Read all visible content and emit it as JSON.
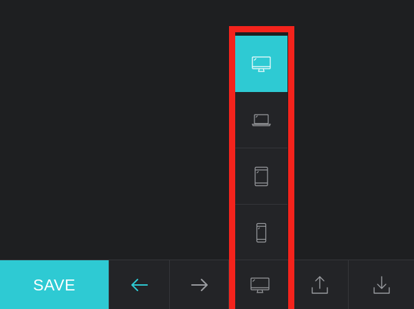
{
  "toolbar": {
    "save_label": "SAVE",
    "buttons": [
      {
        "name": "undo",
        "icon": "arrow-left-icon"
      },
      {
        "name": "redo",
        "icon": "arrow-right-icon"
      },
      {
        "name": "device",
        "icon": "desktop-monitor-icon"
      },
      {
        "name": "upload",
        "icon": "upload-icon"
      },
      {
        "name": "download",
        "icon": "download-icon"
      }
    ]
  },
  "device_menu": {
    "options": [
      {
        "device": "desktop",
        "icon": "desktop-monitor-icon",
        "selected": true
      },
      {
        "device": "laptop",
        "icon": "laptop-icon",
        "selected": false
      },
      {
        "device": "tablet",
        "icon": "tablet-icon",
        "selected": false
      },
      {
        "device": "phone",
        "icon": "phone-icon",
        "selected": false
      }
    ]
  },
  "colors": {
    "accent": "#2ecad3",
    "background": "#1e1f21",
    "panel": "#232427",
    "divider": "#35363a",
    "icon_stroke": "#9a9ca0",
    "highlight": "#f4231c"
  }
}
